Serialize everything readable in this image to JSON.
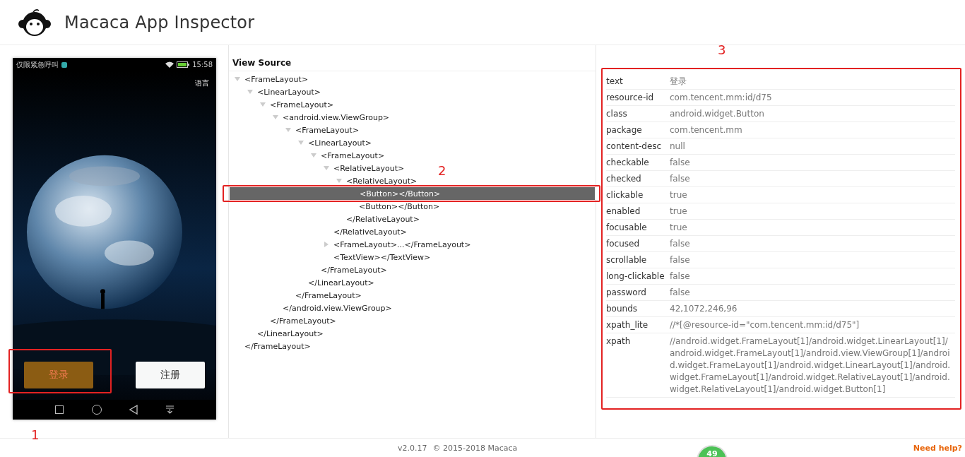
{
  "header": {
    "title": "Macaca App Inspector"
  },
  "device": {
    "status_text": "仅限紧急呼叫",
    "time": "15:58",
    "language_link": "语言",
    "buttons": [
      {
        "label": "登录",
        "kind": "primary"
      },
      {
        "label": "注册",
        "kind": "secondary"
      }
    ]
  },
  "source": {
    "title": "View Source",
    "tree": [
      {
        "open": "<FrameLayout>",
        "close": "</FrameLayout>",
        "expanded": true,
        "selected": false,
        "children": [
          {
            "open": "<LinearLayout>",
            "close": "</LinearLayout>",
            "expanded": true,
            "selected": false,
            "children": [
              {
                "open": "<FrameLayout>",
                "close": "</FrameLayout>",
                "expanded": true,
                "selected": false,
                "children": [
                  {
                    "open": "<android.view.ViewGroup>",
                    "close": "</android.view.ViewGroup>",
                    "expanded": true,
                    "selected": false,
                    "children": [
                      {
                        "open": "<FrameLayout>",
                        "close": "</FrameLayout>",
                        "expanded": true,
                        "selected": false,
                        "children": [
                          {
                            "open": "<LinearLayout>",
                            "close": "</LinearLayout>",
                            "expanded": true,
                            "selected": false,
                            "children": [
                              {
                                "open": "<FrameLayout>",
                                "close": "</FrameLayout>",
                                "expanded": true,
                                "selected": false,
                                "children": [
                                  {
                                    "open": "<RelativeLayout>",
                                    "close": "</RelativeLayout>",
                                    "expanded": true,
                                    "selected": false,
                                    "children": [
                                      {
                                        "open": "<RelativeLayout>",
                                        "close": "</RelativeLayout>",
                                        "expanded": true,
                                        "selected": false,
                                        "children": [
                                          {
                                            "label": "<Button></Button>",
                                            "selected": true
                                          },
                                          {
                                            "label": "<Button></Button>",
                                            "selected": false
                                          }
                                        ]
                                      }
                                    ]
                                  },
                                  {
                                    "label": "<FrameLayout>...</FrameLayout>",
                                    "expanded": false,
                                    "selected": false
                                  },
                                  {
                                    "label": "<TextView></TextView>",
                                    "selected": false
                                  }
                                ]
                              }
                            ]
                          }
                        ]
                      }
                    ]
                  }
                ]
              }
            ]
          }
        ]
      }
    ]
  },
  "properties": [
    {
      "key": "text",
      "value": "登录"
    },
    {
      "key": "resource-id",
      "value": "com.tencent.mm:id/d75"
    },
    {
      "key": "class",
      "value": "android.widget.Button"
    },
    {
      "key": "package",
      "value": "com.tencent.mm"
    },
    {
      "key": "content-desc",
      "value": "null"
    },
    {
      "key": "checkable",
      "value": "false"
    },
    {
      "key": "checked",
      "value": "false"
    },
    {
      "key": "clickable",
      "value": "true"
    },
    {
      "key": "enabled",
      "value": "true"
    },
    {
      "key": "focusable",
      "value": "true"
    },
    {
      "key": "focused",
      "value": "false"
    },
    {
      "key": "scrollable",
      "value": "false"
    },
    {
      "key": "long-clickable",
      "value": "false"
    },
    {
      "key": "password",
      "value": "false"
    },
    {
      "key": "bounds",
      "value": "42,1072,246,96"
    },
    {
      "key": "xpath_lite",
      "value": "//*[@resource-id=\"com.tencent.mm:id/d75\"]"
    },
    {
      "key": "xpath",
      "value": "//android.widget.FrameLayout[1]/android.widget.LinearLayout[1]/android.widget.FrameLayout[1]/android.view.ViewGroup[1]/android.widget.FrameLayout[1]/android.widget.LinearLayout[1]/android.widget.FrameLayout[1]/android.widget.RelativeLayout[1]/android.widget.RelativeLayout[1]/android.widget.Button[1]"
    }
  ],
  "annotations": [
    "1",
    "2",
    "3"
  ],
  "footer": {
    "version": "v2.0.17",
    "copyright": "© 2015-2018 Macaca",
    "badge": "49",
    "help_link": "Need help?"
  }
}
